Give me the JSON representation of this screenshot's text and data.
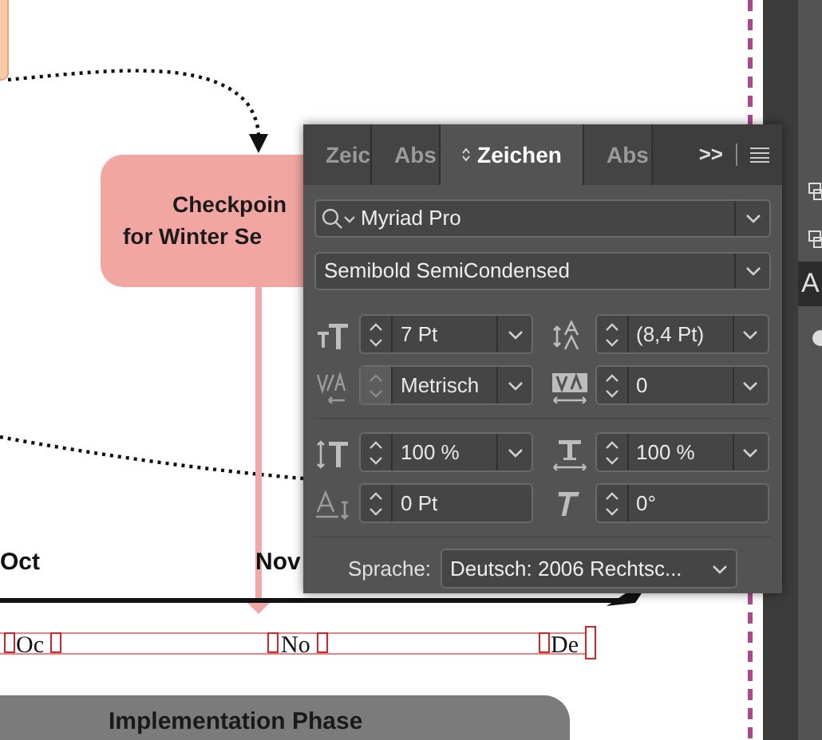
{
  "canvas": {
    "checkpoint_lines": [
      "Checkpoin",
      "for Winter Se"
    ],
    "month_labels": [
      "Oct",
      "Nov"
    ],
    "text_frame": [
      "Oc",
      "No",
      "De"
    ],
    "phase_box": "Implementation Phase"
  },
  "panel": {
    "tabs": [
      {
        "label": "Zeic",
        "selected": false
      },
      {
        "label": "Abs",
        "selected": false
      },
      {
        "label": "Zeichen",
        "selected": true
      },
      {
        "label": "Abs",
        "selected": false
      }
    ],
    "overflow": ">>",
    "font_family": "Myriad Pro",
    "font_style": "Semibold SemiCondensed",
    "fields": [
      {
        "kind": "size",
        "value": "7 Pt",
        "dropdown": true,
        "disabled": false
      },
      {
        "kind": "leading",
        "value": "(8,4 Pt)",
        "dropdown": true,
        "disabled": false
      },
      {
        "kind": "kerning",
        "value": "Metrisch",
        "dropdown": true,
        "disabled": true
      },
      {
        "kind": "tracking",
        "value": "0",
        "dropdown": true,
        "disabled": false
      },
      {
        "kind": "vscale",
        "value": "100 %",
        "dropdown": true,
        "disabled": false
      },
      {
        "kind": "hscale",
        "value": "100 %",
        "dropdown": true,
        "disabled": false
      },
      {
        "kind": "baseline",
        "value": "0 Pt",
        "dropdown": false,
        "disabled": false
      },
      {
        "kind": "skew",
        "value": "0°",
        "dropdown": false,
        "disabled": false
      }
    ],
    "language_label": "Sprache:",
    "language": "Deutsch: 2006 Rechtsc..."
  },
  "toolbar": {
    "tool_label": "A"
  }
}
